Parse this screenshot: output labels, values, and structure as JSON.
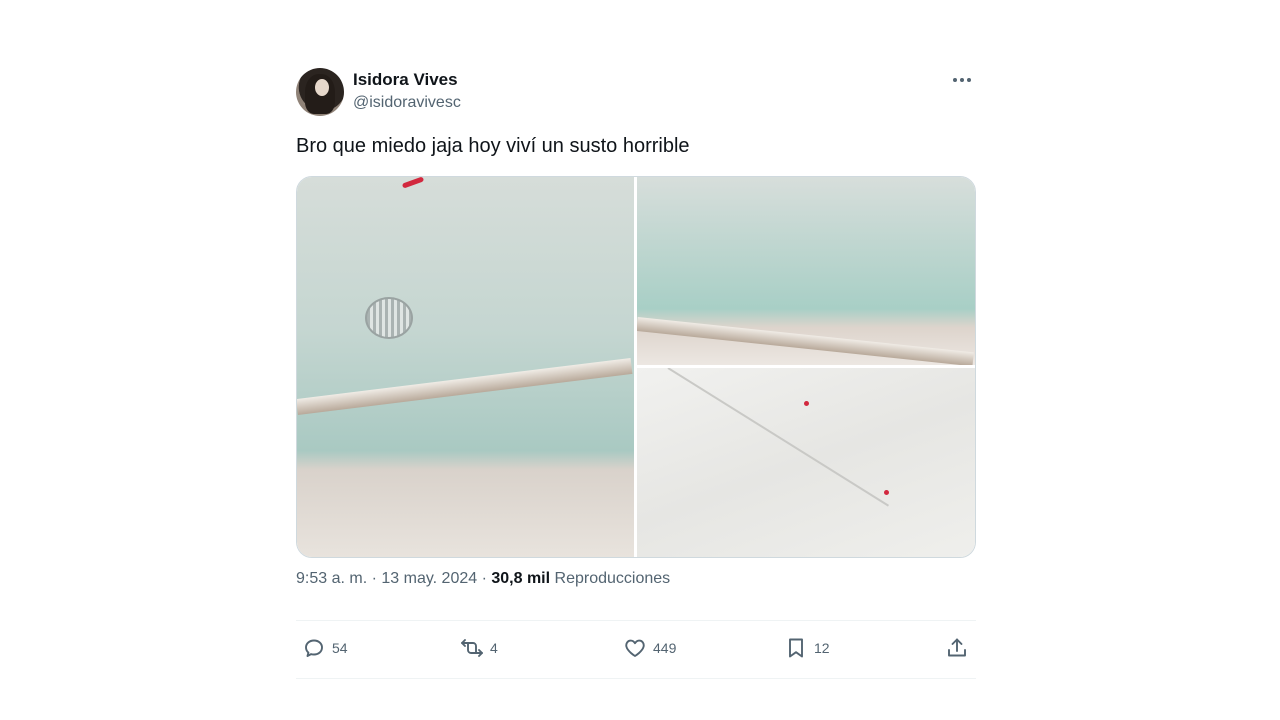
{
  "author": {
    "name": "Isidora Vives",
    "handle": "@isidoravivesc"
  },
  "tweet": {
    "text": "Bro que miedo jaja hoy viví un susto horrible"
  },
  "meta": {
    "time": "9:53 a. m.",
    "sep1": " · ",
    "date": "13 may. 2024",
    "sep2": " · ",
    "views": "30,8 mil",
    "views_label": " Reproducciones"
  },
  "actions": {
    "reply": "54",
    "retweet": "4",
    "like": "449",
    "bookmark": "12"
  },
  "icons": [
    "more-icon",
    "reply-icon",
    "retweet-icon",
    "like-icon",
    "bookmark-icon",
    "share-icon"
  ]
}
